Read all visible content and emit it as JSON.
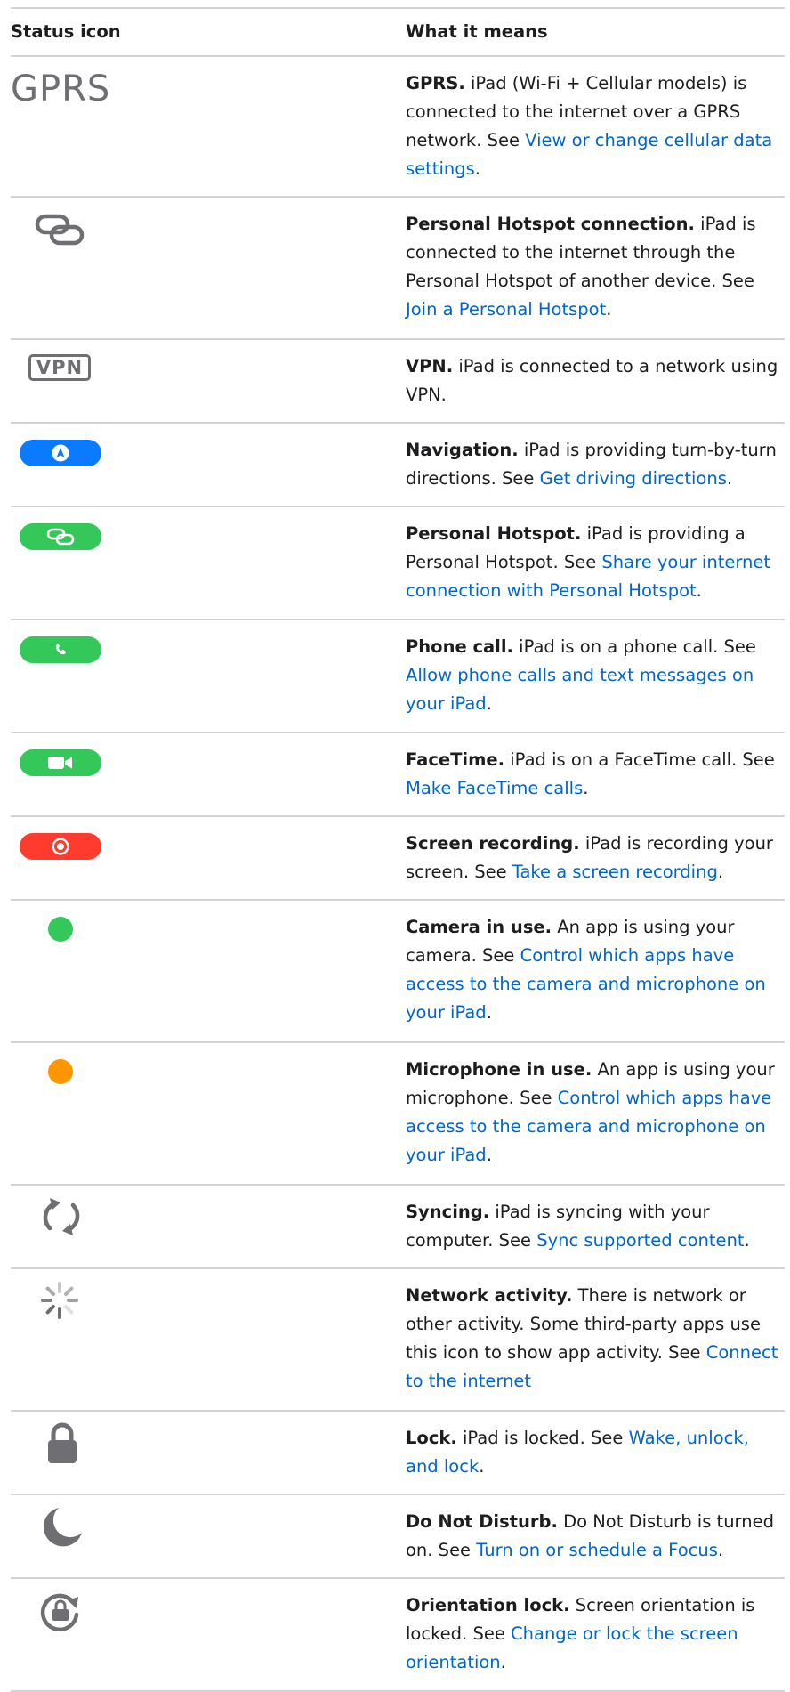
{
  "table": {
    "headers": [
      "Status icon",
      "What it means"
    ],
    "rows": [
      {
        "icon": "gprs-text-icon",
        "icon_text": "GPRS",
        "title": "GPRS.",
        "text": "iPad (Wi-Fi + Cellular models) is connected to the internet over a GPRS network. See",
        "link": "View or change cellular data settings",
        "after": "."
      },
      {
        "icon": "personal-hotspot-connection-icon",
        "title": "Personal Hotspot connection.",
        "text": "iPad is connected to the internet through the Personal Hotspot of another device. See",
        "link": "Join a Personal Hotspot",
        "after": "."
      },
      {
        "icon": "vpn-icon",
        "icon_text": "VPN",
        "title": "VPN.",
        "text": "iPad is connected to a network using VPN.",
        "link": "",
        "after": ""
      },
      {
        "icon": "navigation-icon",
        "title": "Navigation.",
        "text": "iPad is providing turn-by-turn directions. See",
        "link": "Get driving directions",
        "after": "."
      },
      {
        "icon": "personal-hotspot-icon",
        "title": "Personal Hotspot.",
        "text": "iPad is providing a Personal Hotspot. See",
        "link": "Share your internet connection with Personal Hotspot",
        "after": "."
      },
      {
        "icon": "phone-call-icon",
        "title": "Phone call.",
        "text": "iPad is on a phone call. See",
        "link": "Allow phone calls and text messages on your iPad",
        "after": "."
      },
      {
        "icon": "facetime-icon",
        "title": "FaceTime.",
        "text": "iPad is on a FaceTime call. See",
        "link": "Make FaceTime calls",
        "after": "."
      },
      {
        "icon": "screen-recording-icon",
        "title": "Screen recording.",
        "text": "iPad is recording your screen. See",
        "link": "Take a screen recording",
        "after": "."
      },
      {
        "icon": "camera-in-use-icon",
        "title": "Camera in use.",
        "text": "An app is using your camera. See",
        "link": "Control which apps have access to the camera and microphone on your iPad",
        "after": "."
      },
      {
        "icon": "microphone-in-use-icon",
        "title": "Microphone in use.",
        "text": "An app is using your microphone. See",
        "link": "Control which apps have access to the camera and microphone on your iPad",
        "after": "."
      },
      {
        "icon": "syncing-icon",
        "title": "Syncing.",
        "text": "iPad is syncing with your computer. See",
        "link": "Sync supported content",
        "after": "."
      },
      {
        "icon": "network-activity-icon",
        "title": "Network activity.",
        "text": "There is network or other activity. Some third-party apps use this icon to show app activity. See",
        "link": "Connect to the internet",
        "after": ""
      },
      {
        "icon": "lock-icon",
        "title": "Lock.",
        "text": "iPad is locked. See",
        "link": "Wake, unlock, and lock",
        "after": "."
      },
      {
        "icon": "do-not-disturb-icon",
        "title": "Do Not Disturb.",
        "text": "Do Not Disturb is turned on. See",
        "link": "Turn on or schedule a Focus",
        "after": "."
      },
      {
        "icon": "orientation-lock-icon",
        "title": "Orientation lock.",
        "text": "Screen orientation is locked. See",
        "link": "Change or lock the screen orientation",
        "after": "."
      }
    ]
  },
  "colors": {
    "link": "#0066cc",
    "navigation_pill": "#0a7aff",
    "green": "#34c759",
    "red": "#ff3b30",
    "orange": "#ff9500",
    "icon_gray": "#6e6e73"
  }
}
